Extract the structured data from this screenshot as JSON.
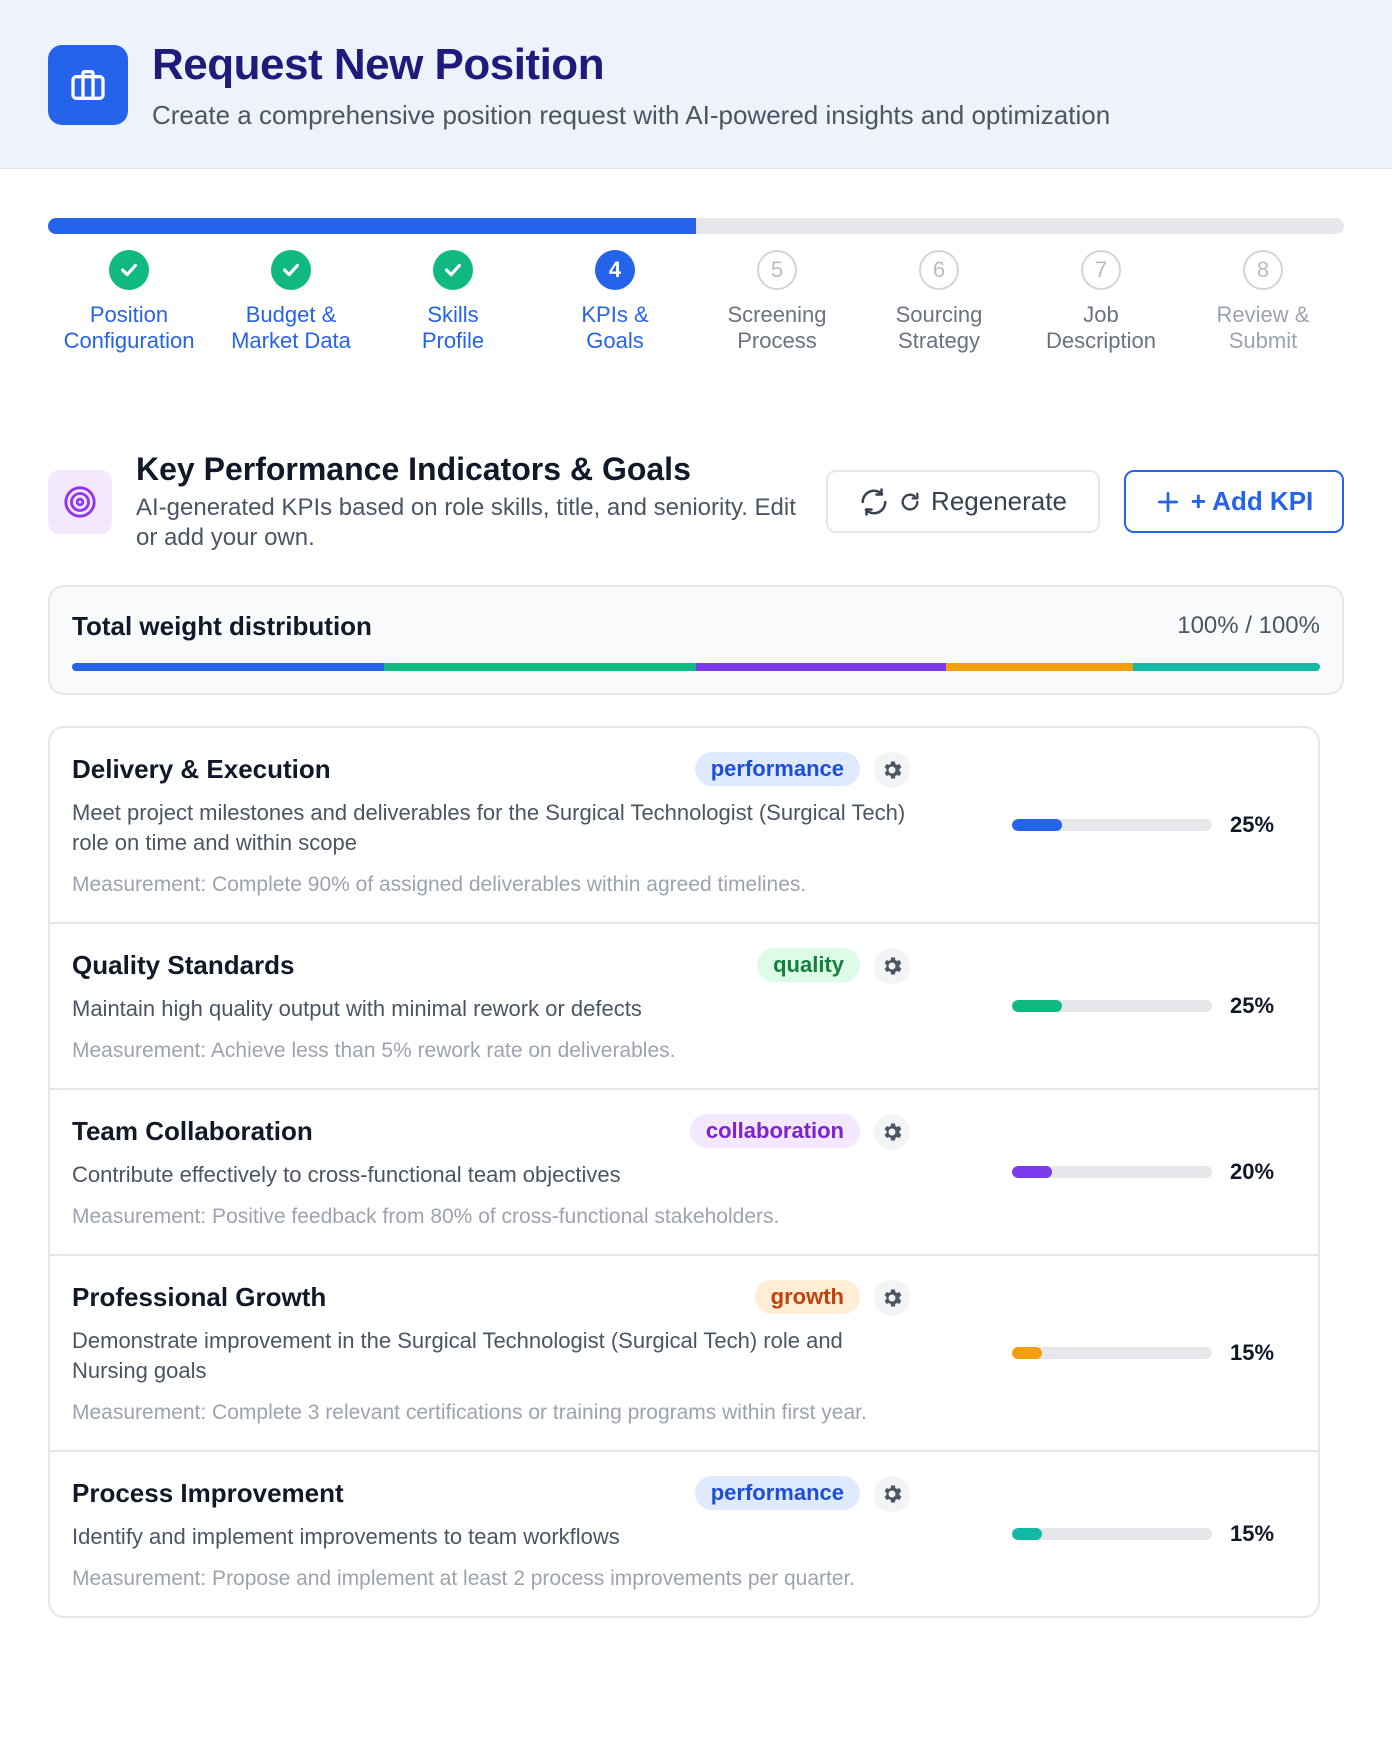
{
  "header": {
    "title": "Request New Position",
    "subtitle": "Create a comprehensive position request with AI-powered insights and optimization",
    "icon": "briefcase-icon"
  },
  "progress": {
    "fraction": 0.5
  },
  "steps": [
    {
      "number": "1",
      "line1": "Position",
      "line2": "Configuration",
      "state": "done"
    },
    {
      "number": "2",
      "line1": "Budget &",
      "line2": "Market Data",
      "state": "done"
    },
    {
      "number": "3",
      "line1": "Skills",
      "line2": "Profile",
      "state": "done"
    },
    {
      "number": "4",
      "line1": "KPIs &",
      "line2": "Goals",
      "state": "active"
    },
    {
      "number": "5",
      "line1": "Screening",
      "line2": "Process",
      "state": "pending"
    },
    {
      "number": "6",
      "line1": "Sourcing",
      "line2": "Strategy",
      "state": "pending"
    },
    {
      "number": "7",
      "line1": "Job",
      "line2": "Description",
      "state": "pending"
    },
    {
      "number": "8",
      "line1": "Review &",
      "line2": "Submit",
      "state": "pending"
    }
  ],
  "section": {
    "icon": "target-icon",
    "title": "Key Performance Indicators & Goals",
    "description": "AI-generated KPIs based on role skills, title, and seniority. Edit or add your own.",
    "regenerate_label": "Regenerate",
    "add_label": "+ Add KPI"
  },
  "weights": {
    "title": "Total weight distribution",
    "total": "100% / 100%"
  },
  "colors": {
    "blue": "#2563eb",
    "green": "#10b981",
    "purple": "#7c3aed",
    "orange": "#f59e0b",
    "teal": "#14b8a6"
  },
  "kpis": [
    {
      "title": "Delivery & Execution",
      "tag": "performance",
      "tag_bg": "#e0eaff",
      "tag_color": "#1d4ed8",
      "description": "Meet project milestones and deliverables for the Surgical Technologist (Surgical Tech) role on time and within scope",
      "measurement": "Measurement: Complete 90% of assigned deliverables within agreed timelines.",
      "weight": 25,
      "weight_label": "25%",
      "color": "#2563eb"
    },
    {
      "title": "Quality Standards",
      "tag": "quality",
      "tag_bg": "#dcfce7",
      "tag_color": "#15803d",
      "description": "Maintain high quality output with minimal rework or defects",
      "measurement": "Measurement: Achieve less than 5% rework rate on deliverables.",
      "weight": 25,
      "weight_label": "25%",
      "color": "#10b981"
    },
    {
      "title": "Team Collaboration",
      "tag": "collaboration",
      "tag_bg": "#f3e8ff",
      "tag_color": "#7e22ce",
      "description": "Contribute effectively to cross-functional team objectives",
      "measurement": "Measurement: Positive feedback from 80% of cross-functional stakeholders.",
      "weight": 20,
      "weight_label": "20%",
      "color": "#7c3aed"
    },
    {
      "title": "Professional Growth",
      "tag": "growth",
      "tag_bg": "#ffedd5",
      "tag_color": "#c2410c",
      "description": "Demonstrate improvement in the Surgical Technologist (Surgical Tech) role and Nursing goals",
      "measurement": "Measurement: Complete 3 relevant certifications or training programs within first year.",
      "weight": 15,
      "weight_label": "15%",
      "color": "#f59e0b"
    },
    {
      "title": "Process Improvement",
      "tag": "performance",
      "tag_bg": "#e0eaff",
      "tag_color": "#1d4ed8",
      "description": "Identify and implement improvements to team workflows",
      "measurement": "Measurement: Propose and implement at least 2 process improvements per quarter.",
      "weight": 15,
      "weight_label": "15%",
      "color": "#14b8a6"
    }
  ]
}
